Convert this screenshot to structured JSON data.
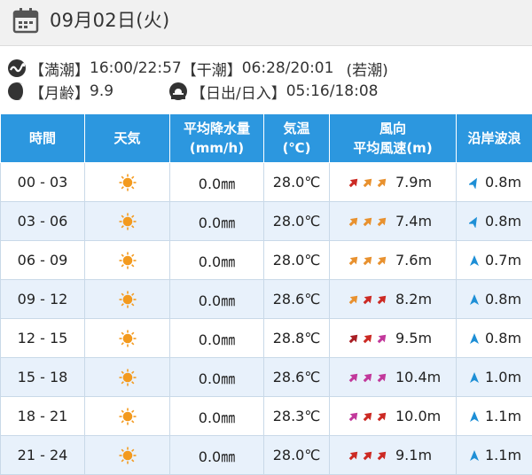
{
  "header": {
    "date": "09月02日(火)",
    "icon": "calendar-icon"
  },
  "tide": {
    "full_label": "【満潮】",
    "full_value": "16:00/22:57",
    "low_label": "【干潮】",
    "low_value": "06:28/20:01",
    "tide_name": "(若潮)"
  },
  "moon": {
    "label": "【月齢】",
    "value": "9.9"
  },
  "sun": {
    "label": "【日出/日入】",
    "value": "05:16/18:08"
  },
  "table": {
    "headers": {
      "time": "時間",
      "weather": "天気",
      "rain_1": "平均降水量",
      "rain_2": "(mm/h)",
      "temp_1": "気温",
      "temp_2": "(℃)",
      "wind_1": "風向",
      "wind_2": "平均風速(m)",
      "wave": "沿岸波浪"
    },
    "rows": [
      {
        "time": "00 - 03",
        "weather": "sunny-icon",
        "rain": "0.0㎜",
        "temp": "28.0℃",
        "wind_colors": [
          "#cc2a24",
          "#e8912f",
          "#e8912f"
        ],
        "wind_rot": [
          225,
          225,
          225
        ],
        "wind": "7.9m",
        "wave_rot": 210,
        "wave": "0.8m"
      },
      {
        "time": "03 - 06",
        "weather": "sunny-icon",
        "rain": "0.0㎜",
        "temp": "28.0℃",
        "wind_colors": [
          "#e8912f",
          "#e8912f",
          "#e8912f"
        ],
        "wind_rot": [
          225,
          225,
          225
        ],
        "wind": "7.4m",
        "wave_rot": 210,
        "wave": "0.8m"
      },
      {
        "time": "06 - 09",
        "weather": "sunny-icon",
        "rain": "0.0㎜",
        "temp": "28.0℃",
        "wind_colors": [
          "#e8912f",
          "#e8912f",
          "#e8912f"
        ],
        "wind_rot": [
          225,
          225,
          225
        ],
        "wind": "7.6m",
        "wave_rot": 180,
        "wave": "0.7m"
      },
      {
        "time": "09 - 12",
        "weather": "sunny-icon",
        "rain": "0.0㎜",
        "temp": "28.6℃",
        "wind_colors": [
          "#e8912f",
          "#cc2a24",
          "#cc2a24"
        ],
        "wind_rot": [
          225,
          225,
          225
        ],
        "wind": "8.2m",
        "wave_rot": 180,
        "wave": "0.8m"
      },
      {
        "time": "12 - 15",
        "weather": "sunny-icon",
        "rain": "0.0㎜",
        "temp": "28.8℃",
        "wind_colors": [
          "#a81e24",
          "#cc2a24",
          "#c2389b"
        ],
        "wind_rot": [
          225,
          225,
          225
        ],
        "wind": "9.5m",
        "wave_rot": 180,
        "wave": "0.8m"
      },
      {
        "time": "15 - 18",
        "weather": "sunny-icon",
        "rain": "0.0㎜",
        "temp": "28.6℃",
        "wind_colors": [
          "#c2389b",
          "#c2389b",
          "#c2389b"
        ],
        "wind_rot": [
          225,
          225,
          225
        ],
        "wind": "10.4m",
        "wave_rot": 180,
        "wave": "1.0m"
      },
      {
        "time": "18 - 21",
        "weather": "sunny-icon",
        "rain": "0.0㎜",
        "temp": "28.3℃",
        "wind_colors": [
          "#c2389b",
          "#cc2a24",
          "#cc2a24"
        ],
        "wind_rot": [
          225,
          225,
          225
        ],
        "wind": "10.0m",
        "wave_rot": 180,
        "wave": "1.1m"
      },
      {
        "time": "21 - 24",
        "weather": "sunny-icon",
        "rain": "0.0㎜",
        "temp": "28.0℃",
        "wind_colors": [
          "#cc2a24",
          "#cc2a24",
          "#cc2a24"
        ],
        "wind_rot": [
          225,
          225,
          225
        ],
        "wind": "9.1m",
        "wave_rot": 180,
        "wave": "1.1m"
      }
    ]
  },
  "colors": {
    "header_bg": "#2c97df",
    "alt_row": "#e8f1fb",
    "sun": "#f39a1e",
    "wave_arrow": "#1e8fd6"
  }
}
